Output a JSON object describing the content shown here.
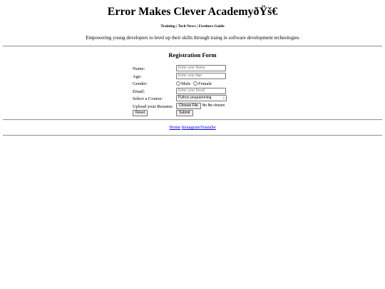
{
  "header": {
    "title": "Error Makes Clever AcademyðŸš€",
    "nav": {
      "training": "Training",
      "sep1": " | ",
      "tech_news": "Tech News",
      "sep2": " | ",
      "freshers_guide": "Freshers Guide"
    },
    "tagline": "Empowering young developers to level up their skills through traing in software development technologies"
  },
  "form": {
    "heading": "Registration Form",
    "name": {
      "label": "Name:",
      "placeholder": "Enter your Name"
    },
    "age": {
      "label": "Age:",
      "placeholder": "Enter your Age"
    },
    "gender": {
      "label": "Gender:",
      "options": [
        "Male",
        "Female"
      ]
    },
    "email": {
      "label": "Email:",
      "placeholder": "Enter your Email"
    },
    "course": {
      "label": "Select a Course:",
      "selected": "Python programming"
    },
    "resume": {
      "label": "Upload your Resume:",
      "button": "Choose File",
      "status": "No file chosen"
    },
    "reset_label": "Reset",
    "submit_label": "Submit"
  },
  "footer": {
    "home": "Home",
    "instagram": "Instagram",
    "youtube": "Youtube"
  }
}
